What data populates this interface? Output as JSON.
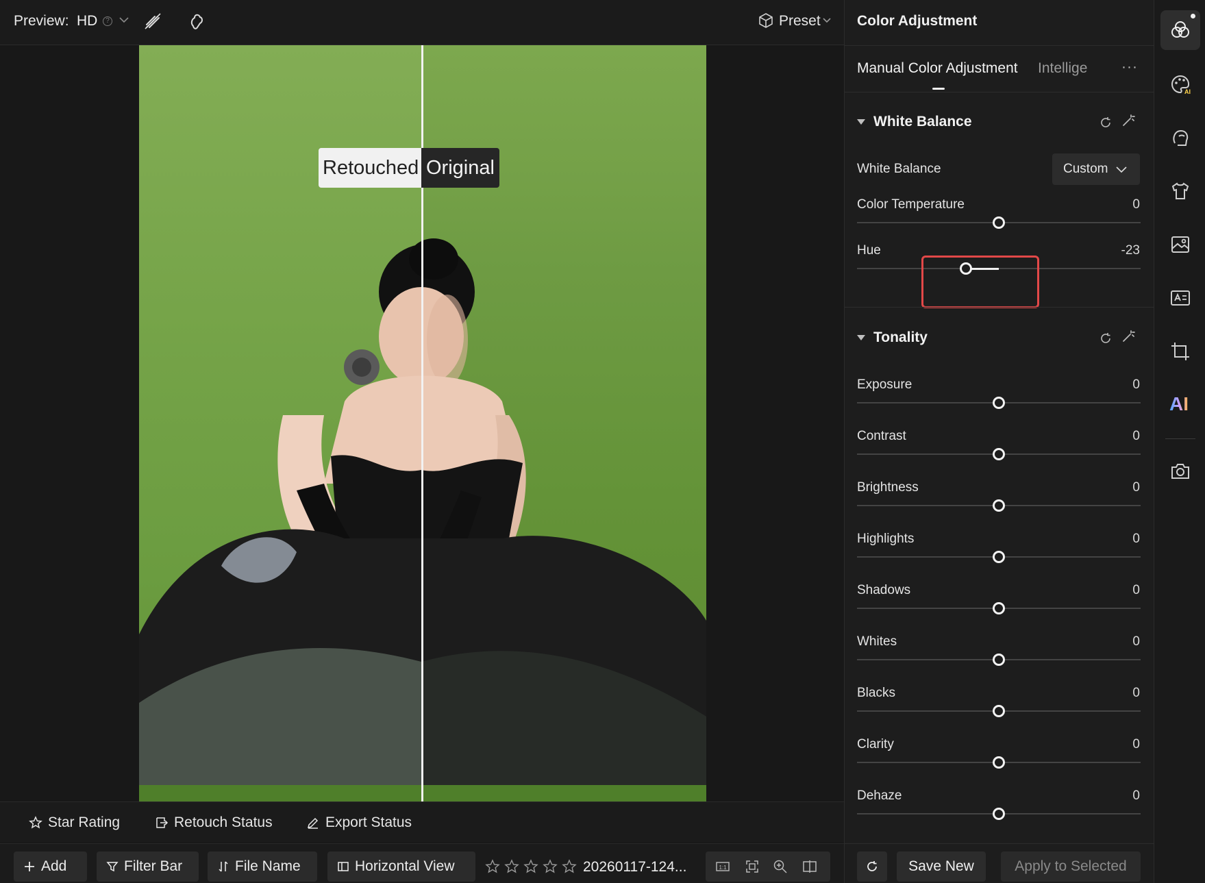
{
  "topbar": {
    "preview_label": "Preview:",
    "quality": "HD",
    "preset_label": "Preset"
  },
  "image": {
    "retouched_label": "Retouched",
    "original_label": "Original"
  },
  "status_strip": {
    "star_rating": "Star Rating",
    "retouch_status": "Retouch Status",
    "export_status": "Export Status"
  },
  "bottombar": {
    "add": "Add",
    "filter_bar": "Filter Bar",
    "file_name": "File Name",
    "horizontal_view": "Horizontal View",
    "filename": "20260117-124...",
    "stars": 0
  },
  "panel": {
    "title": "Color Adjustment",
    "tabs": [
      "Manual Color Adjustment",
      "Intellige"
    ],
    "more": "···",
    "white_balance": {
      "header": "White Balance",
      "wb_label": "White Balance",
      "wb_value": "Custom",
      "sliders": [
        {
          "label": "Color Temperature",
          "value": "0",
          "num": 0
        },
        {
          "label": "Hue",
          "value": "-23",
          "num": -23
        }
      ]
    },
    "tonality": {
      "header": "Tonality",
      "sliders": [
        {
          "label": "Exposure",
          "value": "0",
          "num": 0
        },
        {
          "label": "Contrast",
          "value": "0",
          "num": 0
        },
        {
          "label": "Brightness",
          "value": "0",
          "num": 0
        },
        {
          "label": "Highlights",
          "value": "0",
          "num": 0
        },
        {
          "label": "Shadows",
          "value": "0",
          "num": 0
        },
        {
          "label": "Whites",
          "value": "0",
          "num": 0
        },
        {
          "label": "Blacks",
          "value": "0",
          "num": 0
        },
        {
          "label": "Clarity",
          "value": "0",
          "num": 0
        },
        {
          "label": "Dehaze",
          "value": "0",
          "num": 0
        }
      ]
    },
    "footer": {
      "save_new": "Save New",
      "apply_selected": "Apply to Selected"
    }
  },
  "rail": {
    "ai_label": "AI"
  },
  "colors": {
    "highlight_box": "#e24848",
    "panel_bg": "#1d1d1d",
    "accent": "#f0f0f0"
  }
}
